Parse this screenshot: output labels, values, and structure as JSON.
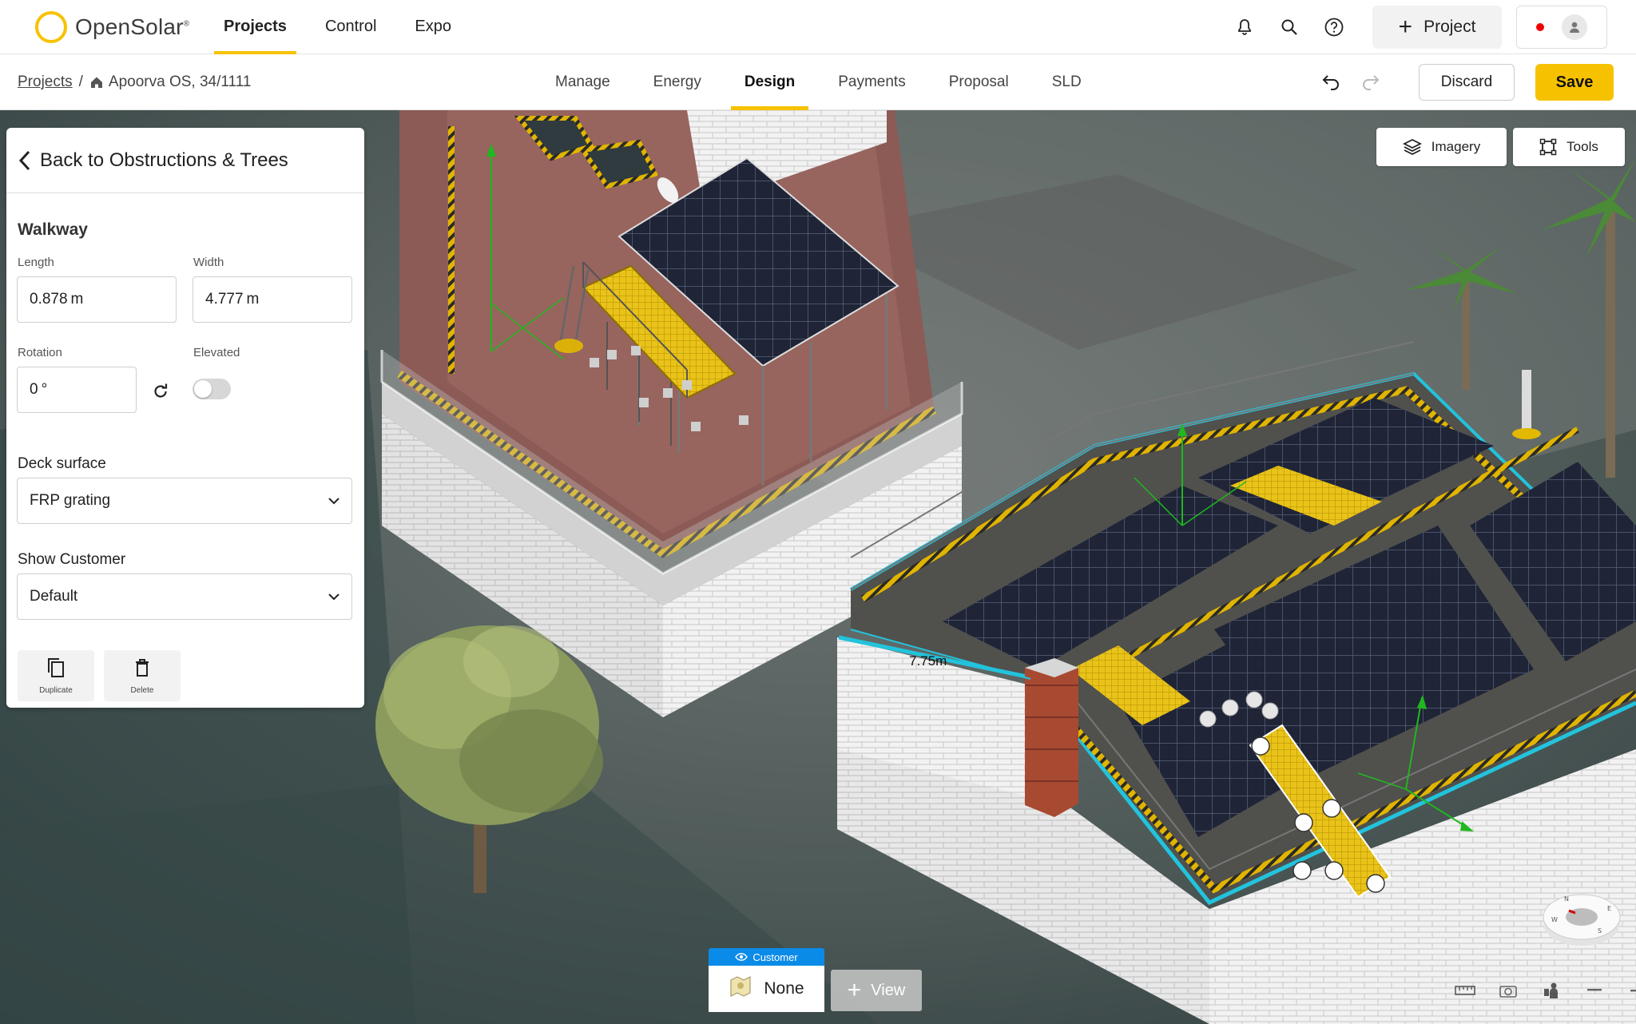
{
  "brand": {
    "name": "OpenSolar",
    "tm": "®"
  },
  "main_nav": [
    {
      "label": "Projects",
      "active": true
    },
    {
      "label": "Control",
      "active": false
    },
    {
      "label": "Expo",
      "active": false
    }
  ],
  "top_actions": {
    "new_project_label": "Project"
  },
  "breadcrumb": {
    "root": "Projects",
    "separator": "/",
    "project": "Apoorva OS, 34/1111"
  },
  "tabs": [
    {
      "label": "Manage",
      "active": false
    },
    {
      "label": "Energy",
      "active": false
    },
    {
      "label": "Design",
      "active": true
    },
    {
      "label": "Payments",
      "active": false
    },
    {
      "label": "Proposal",
      "active": false
    },
    {
      "label": "SLD",
      "active": false
    }
  ],
  "toolbar": {
    "discard_label": "Discard",
    "save_label": "Save"
  },
  "panel": {
    "back_label": "Back to Obstructions & Trees",
    "section_title": "Walkway",
    "length": {
      "label": "Length",
      "value": "0.878",
      "unit": "m"
    },
    "width": {
      "label": "Width",
      "value": "4.777",
      "unit": "m"
    },
    "rotation": {
      "label": "Rotation",
      "value": "0",
      "unit": "°"
    },
    "elevated": {
      "label": "Elevated",
      "on": false
    },
    "deck_surface": {
      "label": "Deck surface",
      "value": "FRP grating"
    },
    "show_customer": {
      "label": "Show Customer",
      "value": "Default"
    },
    "actions": {
      "duplicate": "Duplicate",
      "delete": "Delete"
    }
  },
  "viewport": {
    "imagery_label": "Imagery",
    "tools_label": "Tools",
    "measurement": "7.75m",
    "view_chip": {
      "header": "Customer",
      "value": "None"
    },
    "add_view_label": "View"
  },
  "colors": {
    "accent": "#f6c200",
    "chip_blue": "#0b8be8",
    "recording": "#e00000"
  }
}
